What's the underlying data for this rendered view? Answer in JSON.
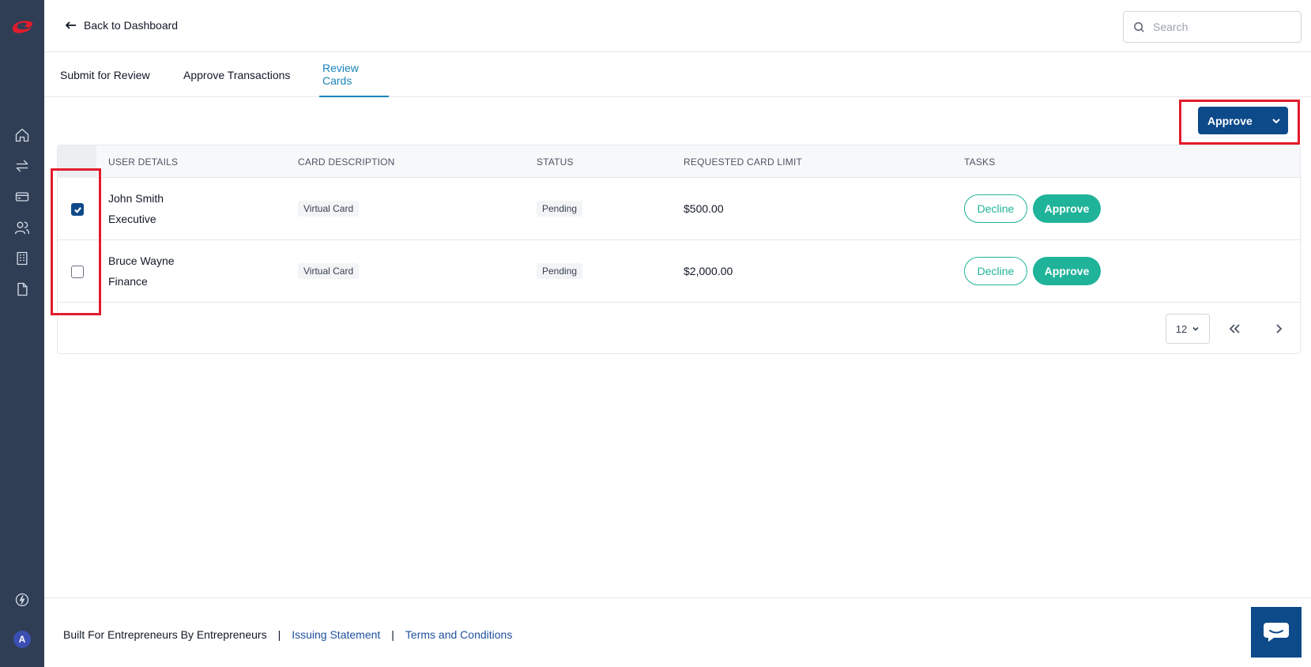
{
  "app": {
    "back_label": "Back to Dashboard",
    "search_placeholder": "Search",
    "avatar_initial": "A"
  },
  "tabs": [
    {
      "label": "Submit for Review",
      "active": false
    },
    {
      "label": "Approve Transactions",
      "active": false
    },
    {
      "label": "Review Cards",
      "active": true
    }
  ],
  "sidebar": {
    "icons": [
      "home-icon",
      "transfer-icon",
      "card-icon",
      "users-icon",
      "building-icon",
      "document-icon",
      "lightning-icon"
    ]
  },
  "bulk_action": {
    "label": "Approve"
  },
  "table": {
    "columns": [
      "USER DETAILS",
      "CARD DESCRIPTION",
      "STATUS",
      "REQUESTED CARD LIMIT",
      "TASKS"
    ],
    "rows": [
      {
        "name": "John Smith",
        "role": "Executive",
        "card": "Virtual Card",
        "status": "Pending",
        "limit": "$500.00",
        "selected": true,
        "decline_label": "Decline",
        "approve_label": "Approve"
      },
      {
        "name": "Bruce Wayne",
        "role": "Finance",
        "card": "Virtual Card",
        "status": "Pending",
        "limit": "$2,000.00",
        "selected": false,
        "decline_label": "Decline",
        "approve_label": "Approve"
      }
    ],
    "page_size": "12"
  },
  "footer": {
    "tagline": "Built For Entrepreneurs By Entrepreneurs",
    "separator": "|",
    "links": [
      "Issuing Statement",
      "Terms and Conditions"
    ]
  },
  "colors": {
    "sidebar": "#2f3e55",
    "primary": "#0d4a8a",
    "accent": "#1fb39a",
    "tab_active": "#1a84b8",
    "highlight": "#e21b2c"
  }
}
